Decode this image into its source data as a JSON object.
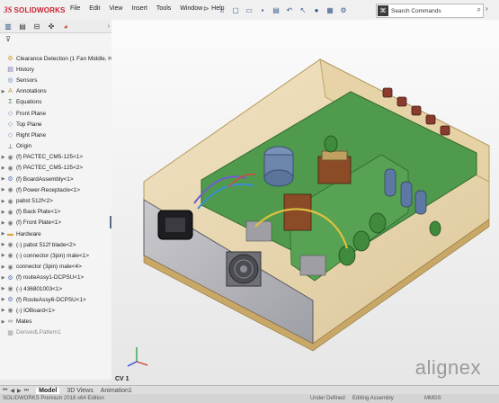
{
  "app": {
    "brand_prefix": "3S",
    "brand_name": "SOLIDWORKS"
  },
  "menu": [
    "File",
    "Edit",
    "View",
    "Insert",
    "Tools",
    "Window",
    "Help"
  ],
  "search": {
    "placeholder": "Search Commands"
  },
  "sidebar": {
    "tree": [
      {
        "label": "Clearance Detection  (1 Fan Middle, H",
        "icon": "assembly",
        "exp": ""
      },
      {
        "label": "History",
        "icon": "history",
        "exp": ""
      },
      {
        "label": "Sensors",
        "icon": "sensor",
        "exp": ""
      },
      {
        "label": "Annotations",
        "icon": "annotation",
        "exp": ">"
      },
      {
        "label": "Equations",
        "icon": "equation",
        "exp": ""
      },
      {
        "label": "Front Plane",
        "icon": "plane",
        "exp": ""
      },
      {
        "label": "Top Plane",
        "icon": "plane",
        "exp": ""
      },
      {
        "label": "Right Plane",
        "icon": "plane",
        "exp": ""
      },
      {
        "label": "Origin",
        "icon": "origin",
        "exp": ""
      },
      {
        "label": "(f) PACTEC_CM5-125<1>",
        "icon": "part",
        "exp": ">"
      },
      {
        "label": "(f) PACTEC_CM5-125<2>",
        "icon": "part",
        "exp": ">"
      },
      {
        "label": "(f) BoardAssembly<1>",
        "icon": "subassembly",
        "exp": ">"
      },
      {
        "label": "(f) Power-Receptacle<1>",
        "icon": "part",
        "exp": ">"
      },
      {
        "label": "pabst 512f<2>",
        "icon": "part",
        "exp": ">"
      },
      {
        "label": "(f) Back Plate<1>",
        "icon": "part",
        "exp": ">"
      },
      {
        "label": "(f) Front Plate<1>",
        "icon": "part",
        "exp": ">"
      },
      {
        "label": "Hardware",
        "icon": "folder",
        "exp": ">"
      },
      {
        "label": "(-) pabst 512f blade<2>",
        "icon": "part",
        "exp": ">"
      },
      {
        "label": "(-) connector (3pin) male<1>",
        "icon": "part",
        "exp": ">"
      },
      {
        "label": "connector (3pin) male<4>",
        "icon": "part",
        "exp": ">"
      },
      {
        "label": "(f) routeAssy1-DCPSU<1>",
        "icon": "subassembly",
        "exp": ">"
      },
      {
        "label": "(-) 436801003<1>",
        "icon": "part",
        "exp": ">"
      },
      {
        "label": "(f) RouteAssy6-DCPSU<1>",
        "icon": "subassembly",
        "exp": ">"
      },
      {
        "label": "(-) IOBoard<1>",
        "icon": "part",
        "exp": ">"
      },
      {
        "label": "Mates",
        "icon": "mates",
        "exp": ">"
      },
      {
        "label": "DerivedLPattern1",
        "icon": "pattern",
        "exp": "",
        "gray": true
      }
    ]
  },
  "viewport": {
    "view_name": "CV 1",
    "brand_watermark": "alignex"
  },
  "bottom_tabs": [
    "Model",
    "3D Views",
    "Animation1"
  ],
  "status": {
    "left": "SOLIDWORKS Premium 2018 x64 Edition",
    "defined": "Under Defined",
    "mode": "Editing Assembly",
    "units": "MMGS"
  },
  "colors": {
    "accent_red": "#cc1f2f",
    "pcb_green": "#4f9a4c",
    "enclosure": "#e3cb93"
  }
}
